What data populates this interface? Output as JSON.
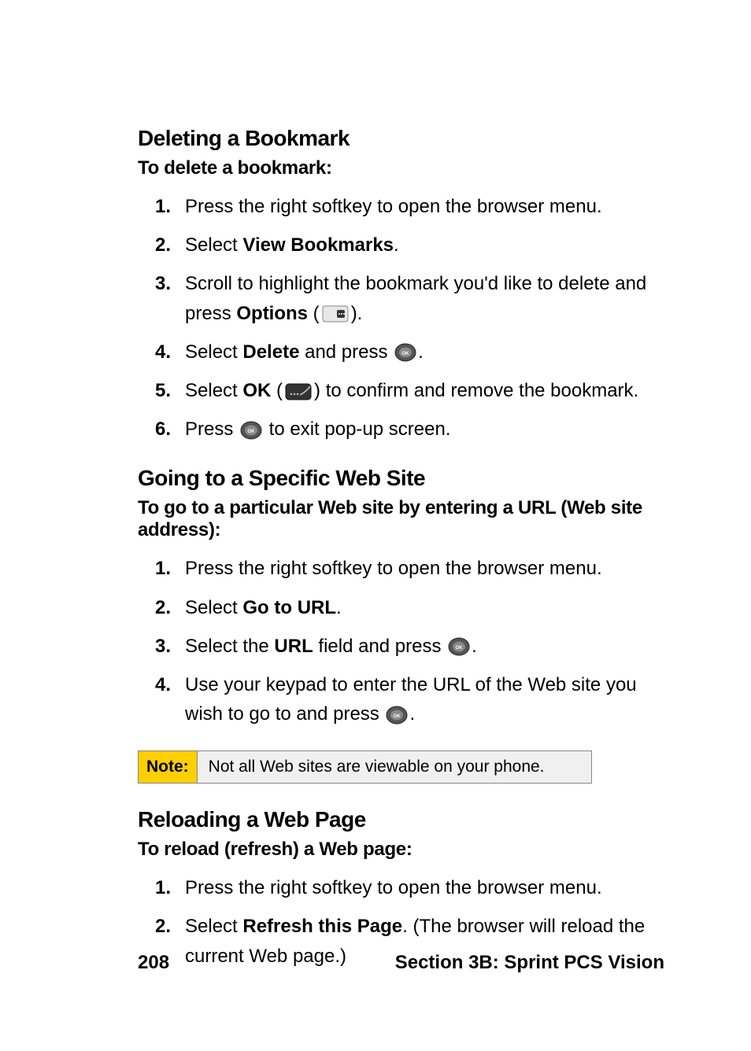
{
  "sections": {
    "deleteBookmark": {
      "heading": "Deleting a Bookmark",
      "lead": "To delete a bookmark:",
      "steps": [
        {
          "num": "1.",
          "pre": "Press the right softkey to open the browser menu."
        },
        {
          "num": "2.",
          "pre": "Select ",
          "bold1": "View Bookmarks",
          "post1": "."
        },
        {
          "num": "3.",
          "pre": "Scroll to highlight the bookmark you'd like to delete and press ",
          "bold1": "Options",
          "post1": " (",
          "icon1": "right-softkey-icon",
          "post2": ")."
        },
        {
          "num": "4.",
          "pre": "Select ",
          "bold1": "Delete",
          "post1": " and press ",
          "icon1": "ok-button-icon",
          "post2": "."
        },
        {
          "num": "5.",
          "pre": "Select ",
          "bold1": "OK",
          "post1": " (",
          "icon1": "left-softkey-icon",
          "post2": ") to confirm and remove the bookmark."
        },
        {
          "num": "6.",
          "pre": "Press ",
          "icon0": "ok-button-icon",
          "post0": " to exit pop-up screen."
        }
      ]
    },
    "gotoSite": {
      "heading": "Going to a Specific Web Site",
      "lead": "To go to a particular Web site by entering a URL (Web site address):",
      "steps": [
        {
          "num": "1.",
          "pre": "Press the right softkey to open the browser menu."
        },
        {
          "num": "2.",
          "pre": "Select ",
          "bold1": "Go to URL",
          "post1": "."
        },
        {
          "num": "3.",
          "pre": "Select the ",
          "bold1": "URL",
          "post1": " field and press ",
          "icon1": "ok-button-icon",
          "post2": "."
        },
        {
          "num": "4.",
          "pre": "Use your keypad to enter the URL of the Web site you wish to go to and press ",
          "icon0": "ok-button-icon",
          "post0": "."
        }
      ]
    },
    "note": {
      "label": "Note:",
      "text": "Not all Web sites are viewable on your phone."
    },
    "reload": {
      "heading": "Reloading a Web Page",
      "lead": "To reload (refresh) a Web page:",
      "steps": [
        {
          "num": "1.",
          "pre": "Press the right softkey to open the browser menu."
        },
        {
          "num": "2.",
          "pre": "Select ",
          "bold1": "Refresh this Page",
          "post1": ". (The browser will reload the current Web page.)"
        }
      ]
    }
  },
  "footer": {
    "page": "208",
    "section": "Section 3B: Sprint PCS Vision"
  }
}
